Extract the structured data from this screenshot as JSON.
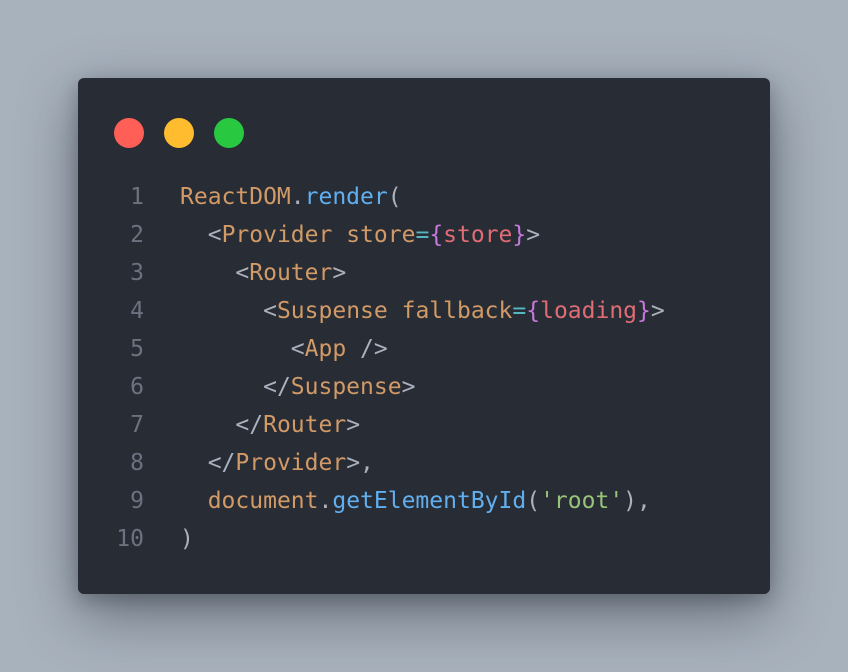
{
  "colors": {
    "background": "#a8b2bd",
    "window": "#282c35",
    "dot_red": "#ff5f57",
    "dot_yellow": "#febc2e",
    "dot_green": "#28c840",
    "plain": "#abb2bf",
    "identifier": "#d19a66",
    "function": "#61afef",
    "operator": "#56b6c2",
    "brace": "#c678dd",
    "variable": "#e06c75",
    "string": "#98c379",
    "line_number": "#6b7280"
  },
  "window": {
    "controls": [
      {
        "name": "close-dot",
        "color": "dot_red"
      },
      {
        "name": "minimize-dot",
        "color": "dot_yellow"
      },
      {
        "name": "maximize-dot",
        "color": "dot_green"
      }
    ]
  },
  "code": {
    "lines": [
      {
        "number": "1",
        "tokens": [
          {
            "text": "ReactDOM",
            "color": "identifier"
          },
          {
            "text": ".",
            "color": "plain"
          },
          {
            "text": "render",
            "color": "function"
          },
          {
            "text": "(",
            "color": "plain"
          }
        ]
      },
      {
        "number": "2",
        "tokens": [
          {
            "text": "  ",
            "color": "plain"
          },
          {
            "text": "<",
            "color": "plain"
          },
          {
            "text": "Provider",
            "color": "identifier"
          },
          {
            "text": " ",
            "color": "plain"
          },
          {
            "text": "store",
            "color": "identifier"
          },
          {
            "text": "=",
            "color": "operator"
          },
          {
            "text": "{",
            "color": "brace"
          },
          {
            "text": "store",
            "color": "variable"
          },
          {
            "text": "}",
            "color": "brace"
          },
          {
            "text": ">",
            "color": "plain"
          }
        ]
      },
      {
        "number": "3",
        "tokens": [
          {
            "text": "    ",
            "color": "plain"
          },
          {
            "text": "<",
            "color": "plain"
          },
          {
            "text": "Router",
            "color": "identifier"
          },
          {
            "text": ">",
            "color": "plain"
          }
        ]
      },
      {
        "number": "4",
        "tokens": [
          {
            "text": "      ",
            "color": "plain"
          },
          {
            "text": "<",
            "color": "plain"
          },
          {
            "text": "Suspense",
            "color": "identifier"
          },
          {
            "text": " ",
            "color": "plain"
          },
          {
            "text": "fallback",
            "color": "identifier"
          },
          {
            "text": "=",
            "color": "operator"
          },
          {
            "text": "{",
            "color": "brace"
          },
          {
            "text": "loading",
            "color": "variable"
          },
          {
            "text": "}",
            "color": "brace"
          },
          {
            "text": ">",
            "color": "plain"
          }
        ]
      },
      {
        "number": "5",
        "tokens": [
          {
            "text": "        ",
            "color": "plain"
          },
          {
            "text": "<",
            "color": "plain"
          },
          {
            "text": "App",
            "color": "identifier"
          },
          {
            "text": " />",
            "color": "plain"
          }
        ]
      },
      {
        "number": "6",
        "tokens": [
          {
            "text": "      ",
            "color": "plain"
          },
          {
            "text": "</",
            "color": "plain"
          },
          {
            "text": "Suspense",
            "color": "identifier"
          },
          {
            "text": ">",
            "color": "plain"
          }
        ]
      },
      {
        "number": "7",
        "tokens": [
          {
            "text": "    ",
            "color": "plain"
          },
          {
            "text": "</",
            "color": "plain"
          },
          {
            "text": "Router",
            "color": "identifier"
          },
          {
            "text": ">",
            "color": "plain"
          }
        ]
      },
      {
        "number": "8",
        "tokens": [
          {
            "text": "  ",
            "color": "plain"
          },
          {
            "text": "</",
            "color": "plain"
          },
          {
            "text": "Provider",
            "color": "identifier"
          },
          {
            "text": ">,",
            "color": "plain"
          }
        ]
      },
      {
        "number": "9",
        "tokens": [
          {
            "text": "  ",
            "color": "plain"
          },
          {
            "text": "document",
            "color": "identifier"
          },
          {
            "text": ".",
            "color": "plain"
          },
          {
            "text": "getElementById",
            "color": "function"
          },
          {
            "text": "(",
            "color": "plain"
          },
          {
            "text": "'root'",
            "color": "string"
          },
          {
            "text": "),",
            "color": "plain"
          }
        ]
      },
      {
        "number": "10",
        "tokens": [
          {
            "text": ")",
            "color": "plain"
          }
        ]
      }
    ]
  }
}
